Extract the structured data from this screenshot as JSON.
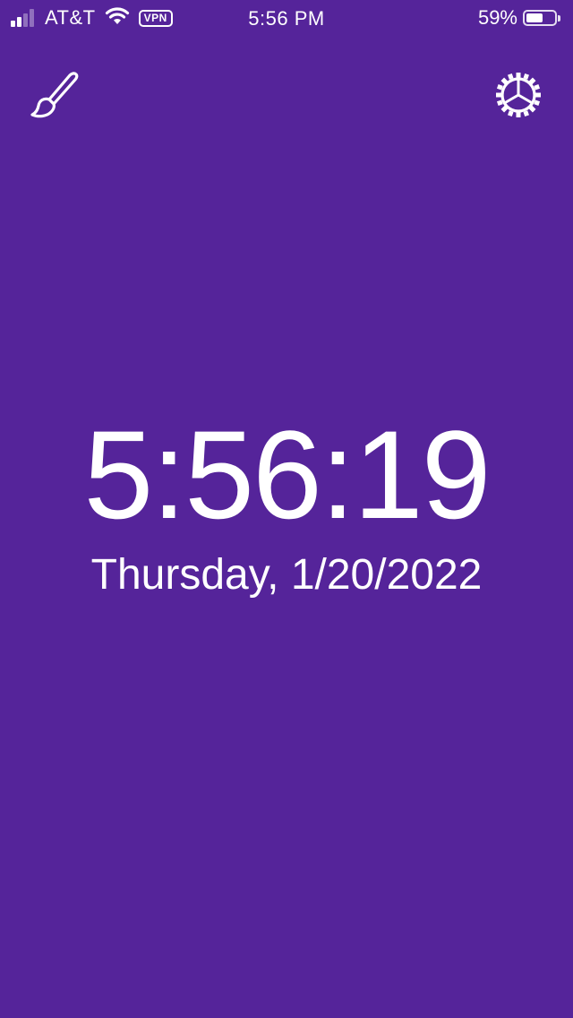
{
  "status_bar": {
    "carrier": "AT&T",
    "vpn_label": "VPN",
    "time": "5:56 PM",
    "battery_percent": "59%",
    "battery_level": 0.59,
    "signal_bars_filled": 2,
    "signal_bars_total": 4,
    "wifi_icon": "wifi-icon"
  },
  "toolbar": {
    "left_icon": "paintbrush-icon",
    "right_icon": "gear-icon"
  },
  "clock": {
    "time": "5:56:19",
    "date": "Thursday, 1/20/2022"
  },
  "colors": {
    "background": "#55249a",
    "foreground": "#ffffff"
  }
}
